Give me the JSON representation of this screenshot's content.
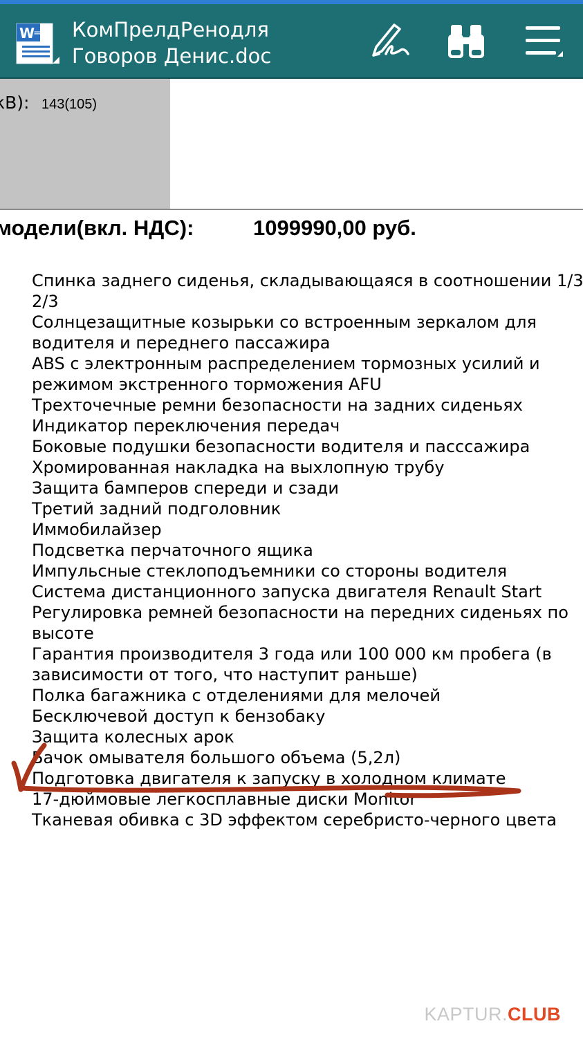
{
  "toolbar": {
    "title_line1": "КомПрелдРенодля",
    "title_line2": "Говоров Денис.doc",
    "icons": [
      "word-document-icon",
      "pen-sign-icon",
      "binoculars-find-icon",
      "hamburger-menu-icon"
    ]
  },
  "document": {
    "power_label": "кВ):",
    "power_value": "143(105)",
    "price_label": "модели(вкл. НДС):",
    "price_value": "1099990,00 руб.",
    "features": [
      "Спинка заднего сиденья, складывающаяся в соотношении 1/3 2/3",
      "Солнцезащитные козырьки со встроенным зеркалом для водителя и переднего пассажира",
      "ABS с электронным распределением тормозных усилий и режимом экстренного торможения AFU",
      "Трехточечные ремни безопасности на задних сиденьях",
      "Индикатор переключения передач",
      "Боковые подушки безопасности водителя и пасссажира",
      "Хромированная накладка на выхлопную трубу",
      "Защита бамперов спереди и сзади",
      "Третий задний подголовник",
      "Иммобилайзер",
      "Подсветка перчаточного ящика",
      "Импульсные стеклоподъемники со стороны водителя",
      "Система дистанционного запуска двигателя Renault Start",
      "Регулировка ремней безопасности на передних сиденьях по высоте",
      "Гарантия производителя 3 года или 100 000 км пробега (в зависимости от того, что наступит раньше)",
      "Полка багажника с  отделениями для мелочей",
      "Бесключевой доступ к бензобаку",
      "Защита колесных арок",
      "Бачок омывателя большого объема (5,2л)",
      "Подготовка двигателя к запуску в холодном климате",
      "17-дюймовые легкосплавные диски Monitor",
      "Тканевая обивка с 3D эффектом серебристо-черного цвета"
    ]
  },
  "watermark": {
    "brand": "KAPTUR.",
    "club": "CLUB"
  },
  "colors": {
    "toolbar": "#1e6f74",
    "annotation_stroke": "#a9341a",
    "watermark_accent": "#e14a22"
  }
}
